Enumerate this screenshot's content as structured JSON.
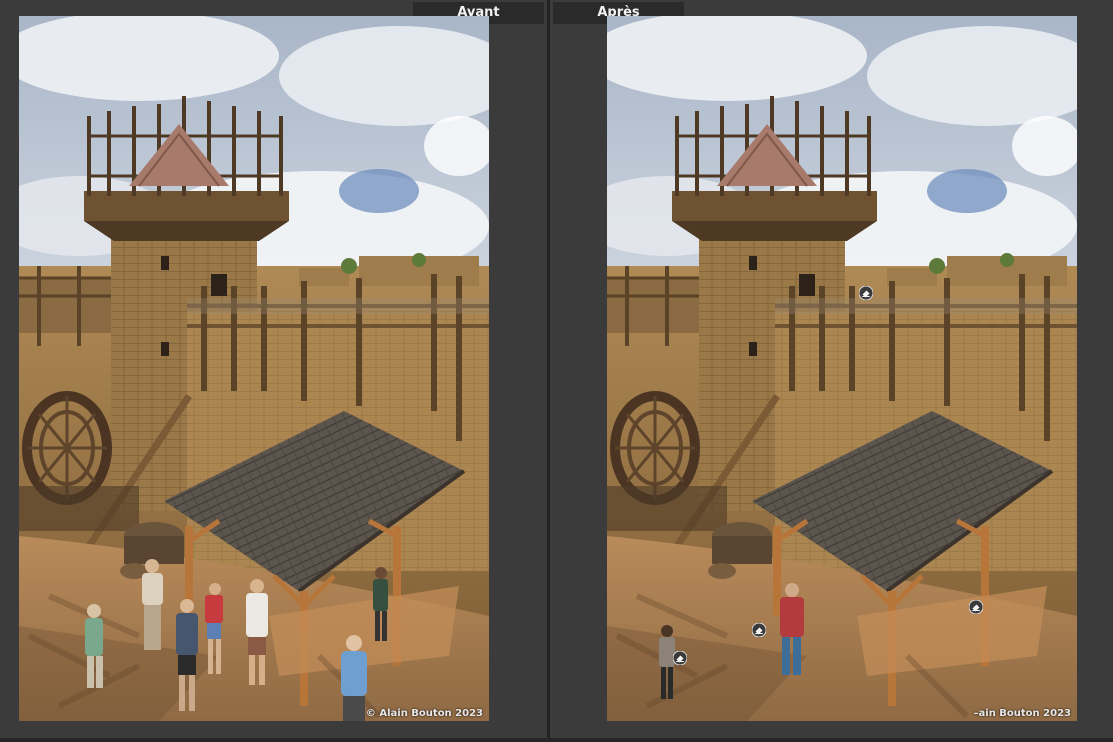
{
  "comparison": {
    "before_label": "Avant",
    "after_label": "Après"
  },
  "photo": {
    "watermark_before": "© Alain Bouton 2023",
    "watermark_after": "–ain Bouton 2023"
  },
  "markers": [
    {
      "icon": "eraser-pin-icon"
    },
    {
      "icon": "eraser-pin-icon"
    },
    {
      "icon": "eraser-pin-icon"
    },
    {
      "icon": "eraser-pin-icon"
    }
  ]
}
